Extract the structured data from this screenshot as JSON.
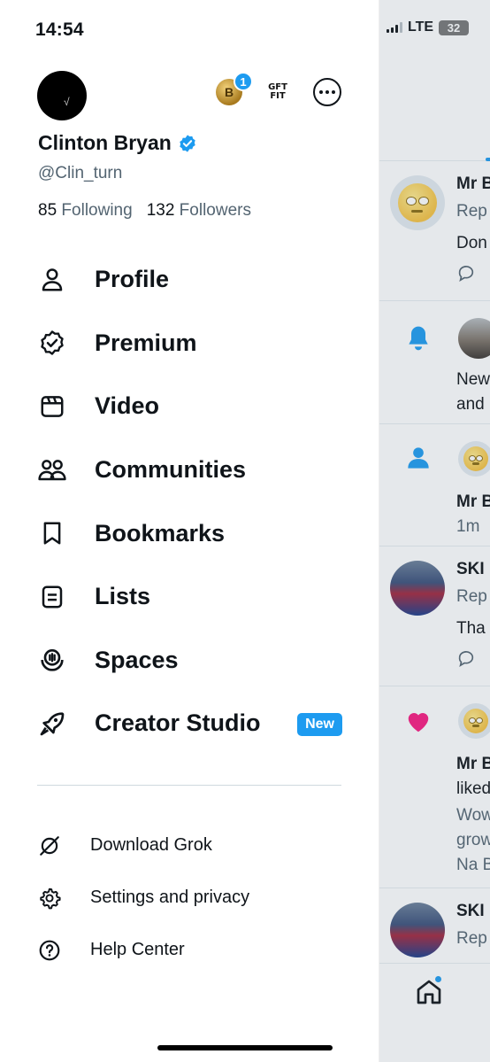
{
  "status": {
    "time": "14:54",
    "network": "LTE",
    "battery": "32"
  },
  "profile": {
    "display_name": "Clinton Bryan",
    "handle": "@Clin_turn",
    "following_count": "85",
    "following_label": "Following",
    "followers_count": "132",
    "followers_label": "Followers",
    "verified": true
  },
  "accounts": {
    "badge_count": "1",
    "coin_letter": "B",
    "logo_line1": "GFT",
    "logo_line2": "FIT"
  },
  "menu": [
    {
      "label": "Profile",
      "icon": "person-icon"
    },
    {
      "label": "Premium",
      "icon": "verified-badge-icon"
    },
    {
      "label": "Video",
      "icon": "video-icon"
    },
    {
      "label": "Communities",
      "icon": "communities-icon"
    },
    {
      "label": "Bookmarks",
      "icon": "bookmark-icon"
    },
    {
      "label": "Lists",
      "icon": "list-icon"
    },
    {
      "label": "Spaces",
      "icon": "spaces-icon"
    },
    {
      "label": "Creator Studio",
      "icon": "rocket-icon",
      "badge": "New"
    }
  ],
  "sub_menu": [
    {
      "label": "Download Grok",
      "icon": "grok-icon"
    },
    {
      "label": "Settings and privacy",
      "icon": "gear-icon"
    },
    {
      "label": "Help Center",
      "icon": "help-icon"
    }
  ],
  "background_feed": {
    "items": [
      {
        "name": "Mr B",
        "sub": "Rep",
        "text": "Don"
      },
      {
        "line1": "New",
        "line2": "and"
      },
      {
        "name": "Mr B",
        "sub": "1m"
      },
      {
        "name": "SKI",
        "sub": "Rep",
        "text": "Tha"
      },
      {
        "name": "Mr B",
        "line1": "liked",
        "line2": "Wow",
        "line3": "grow",
        "line4": "Na B"
      },
      {
        "name": "SKI",
        "sub": "Rep"
      }
    ]
  },
  "colors": {
    "accent": "#1d9bf0",
    "text": "#0f1419",
    "muted": "#536471",
    "like": "#f91880"
  }
}
